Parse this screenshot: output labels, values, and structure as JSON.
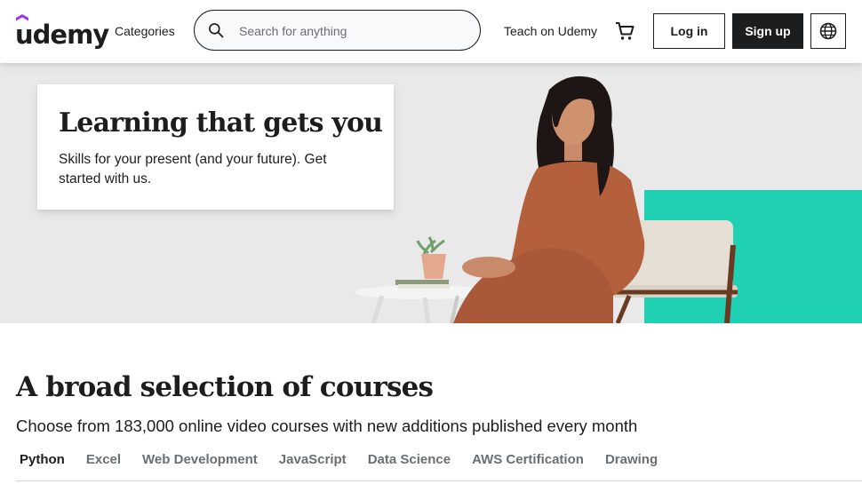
{
  "header": {
    "logo_text": "udemy",
    "categories_label": "Categories",
    "search_placeholder": "Search for anything",
    "teach_label": "Teach on Udemy",
    "login_label": "Log in",
    "signup_label": "Sign up",
    "icons": {
      "search": "search-icon",
      "cart": "cart-icon",
      "language": "globe-icon"
    },
    "brand_color": "#a435f0"
  },
  "hero": {
    "title": "Learning that gets you",
    "subtitle": "Skills for your present (and your future). Get started with us.",
    "accent_color": "#1fd0b3"
  },
  "courses": {
    "title": "A broad selection of courses",
    "subtitle": "Choose from 183,000 online video courses with new additions published every month",
    "tabs": [
      {
        "label": "Python",
        "active": true
      },
      {
        "label": "Excel",
        "active": false
      },
      {
        "label": "Web Development",
        "active": false
      },
      {
        "label": "JavaScript",
        "active": false
      },
      {
        "label": "Data Science",
        "active": false
      },
      {
        "label": "AWS Certification",
        "active": false
      },
      {
        "label": "Drawing",
        "active": false
      }
    ]
  }
}
